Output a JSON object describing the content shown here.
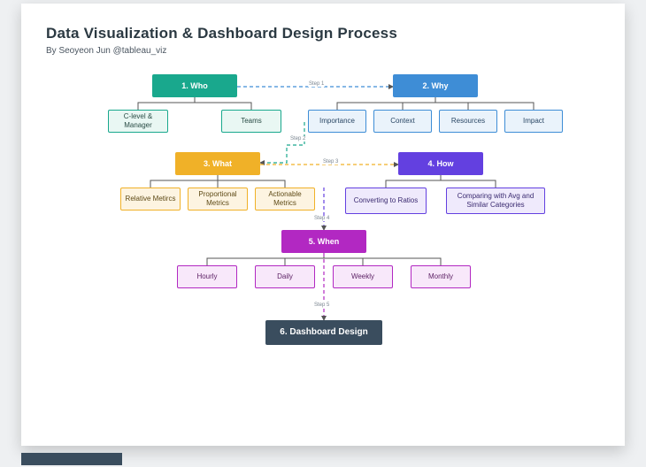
{
  "header": {
    "title": "Data Visualization & Dashboard Design Process",
    "byline": "By Seoyeon Jun @tableau_viz"
  },
  "steps": {
    "s1": "Step 1",
    "s2": "Step 2",
    "s3": "Step 3",
    "s4": "Step 4",
    "s5": "Step 5"
  },
  "nodes": {
    "who": {
      "label": "1. Who",
      "color": "#19a88d",
      "text": "#ffffff"
    },
    "why": {
      "label": "2. Why",
      "color": "#3e8dd6",
      "text": "#ffffff"
    },
    "what": {
      "label": "3. What",
      "color": "#f0b128",
      "text": "#ffffff"
    },
    "how": {
      "label": "4. How",
      "color": "#6340e0",
      "text": "#ffffff"
    },
    "when": {
      "label": "5. When",
      "color": "#b228c2",
      "text": "#ffffff"
    },
    "dash": {
      "label": "6. Dashboard Design",
      "color": "#3a4d5e",
      "text": "#ffffff"
    },
    "who_a": {
      "label": "C-level & Manager",
      "border": "#19a88d",
      "fill": "#e9f7f3"
    },
    "who_b": {
      "label": "Teams",
      "border": "#19a88d",
      "fill": "#e9f7f3"
    },
    "why_a": {
      "label": "Importance",
      "border": "#3e8dd6",
      "fill": "#eaf3fb"
    },
    "why_b": {
      "label": "Context",
      "border": "#3e8dd6",
      "fill": "#eaf3fb"
    },
    "why_c": {
      "label": "Resources",
      "border": "#3e8dd6",
      "fill": "#eaf3fb"
    },
    "why_d": {
      "label": "Impact",
      "border": "#3e8dd6",
      "fill": "#eaf3fb"
    },
    "what_a": {
      "label": "Relative Metircs",
      "border": "#f0b128",
      "fill": "#fdf4e1"
    },
    "what_b": {
      "label": "Proportional Metrics",
      "border": "#f0b128",
      "fill": "#fdf4e1"
    },
    "what_c": {
      "label": "Actionable Metrics",
      "border": "#f0b128",
      "fill": "#fdf4e1"
    },
    "how_a": {
      "label": "Converting to Ratios",
      "border": "#6340e0",
      "fill": "#efeafc"
    },
    "how_b": {
      "label": "Comparing with Avg and Similar Categories",
      "border": "#6340e0",
      "fill": "#efeafc"
    },
    "when_a": {
      "label": "Hourly",
      "border": "#b228c2",
      "fill": "#f8e8fa"
    },
    "when_b": {
      "label": "Daily",
      "border": "#b228c2",
      "fill": "#f8e8fa"
    },
    "when_c": {
      "label": "Weekly",
      "border": "#b228c2",
      "fill": "#f8e8fa"
    },
    "when_d": {
      "label": "Monthly",
      "border": "#b228c2",
      "fill": "#f8e8fa"
    }
  }
}
